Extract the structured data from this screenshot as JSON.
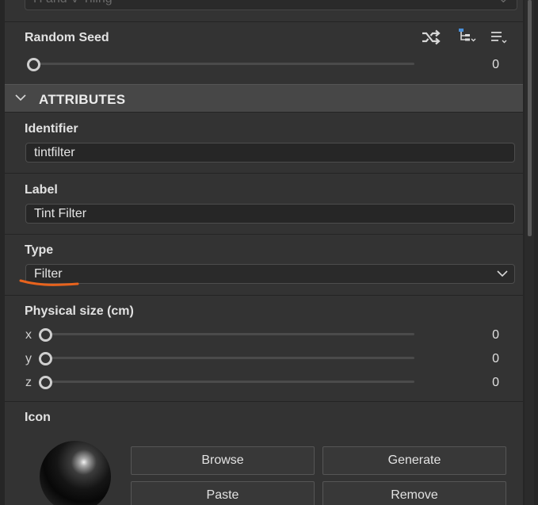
{
  "top_field": {
    "value": "H and V Tiling",
    "caret": "⌄"
  },
  "random_seed": {
    "label": "Random Seed",
    "value": "0",
    "level": 0,
    "icons": [
      "shuffle-icon",
      "hierarchy-icon",
      "list-options-icon"
    ]
  },
  "attributes_header": {
    "title": "ATTRIBUTES",
    "icon": "chevron-down-icon"
  },
  "identifier": {
    "label": "Identifier",
    "value": "tintfilter"
  },
  "label_field": {
    "label": "Label",
    "value": "Tint Filter"
  },
  "type_field": {
    "label": "Type",
    "value": "Filter",
    "caret": "chevron-down-icon"
  },
  "physical_size": {
    "label": "Physical size (cm)",
    "axes": [
      {
        "name": "x",
        "value": "0",
        "level": 0
      },
      {
        "name": "y",
        "value": "0",
        "level": 0
      },
      {
        "name": "z",
        "value": "0",
        "level": 0
      }
    ]
  },
  "icon_section": {
    "label": "Icon",
    "buttons": {
      "browse": "Browse",
      "generate": "Generate",
      "paste": "Paste",
      "remove": "Remove"
    }
  },
  "colors": {
    "annotation": "#e8631d",
    "panel": "#333333",
    "header": "#474747",
    "accent": "#4a90d9"
  }
}
